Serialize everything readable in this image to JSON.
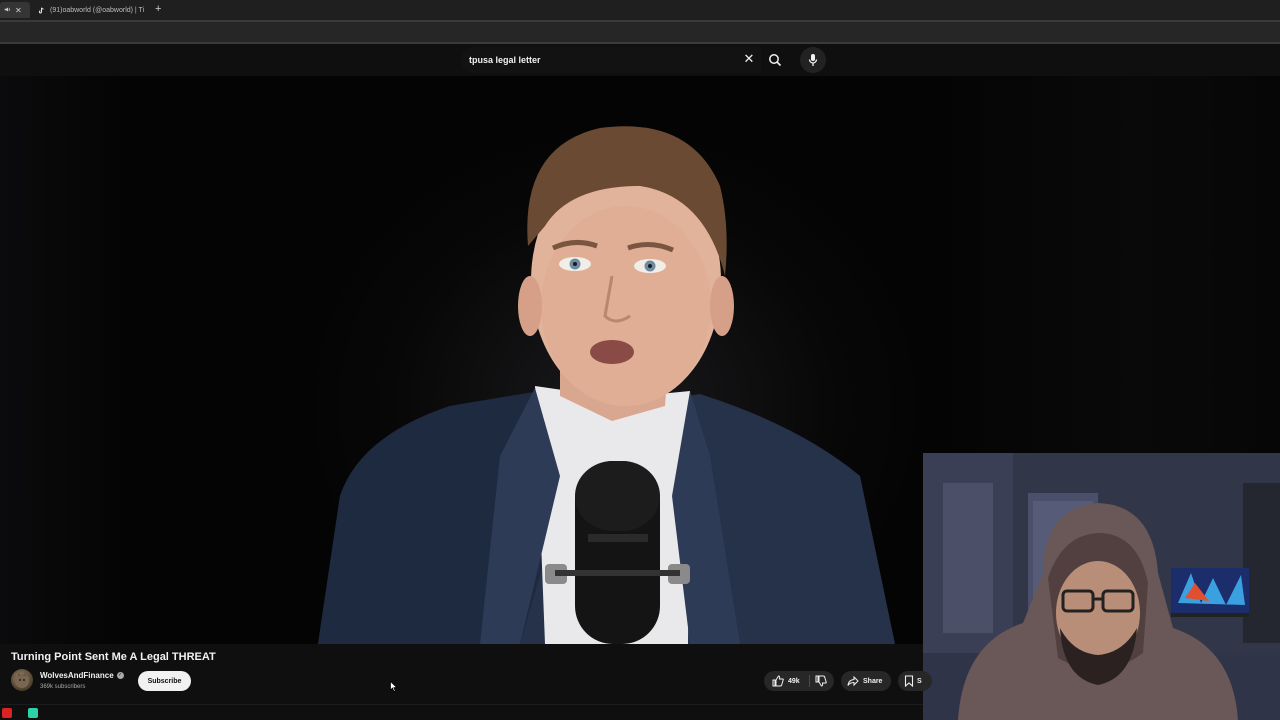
{
  "browser": {
    "tabs": [
      {
        "label": "",
        "icons": [
          "speaker-icon",
          "close-icon"
        ]
      },
      {
        "label": "(91)oabworld (@oabworld) | Ti",
        "icons": [
          "tiktok-icon"
        ]
      }
    ],
    "new_tab": "+"
  },
  "search": {
    "query": "tpusa legal letter",
    "icons": [
      "clear-icon",
      "search-icon",
      "mic-icon"
    ]
  },
  "video": {
    "title": "Turning Point Sent Me A Legal THREAT",
    "channel": {
      "name": "WolvesAndFinance",
      "subscribers": "369k subscribers",
      "verified_icon": "verified-icon"
    },
    "subscribe_label": "Subscribe",
    "likes": "49k",
    "share_label": "Share",
    "save_label": "S"
  },
  "colors": {
    "background": "#0f0f0f",
    "pill": "#272727",
    "subscribe_bg": "#f1f1f1",
    "text": "#f1f1f1",
    "muted": "#aaaaaa"
  }
}
